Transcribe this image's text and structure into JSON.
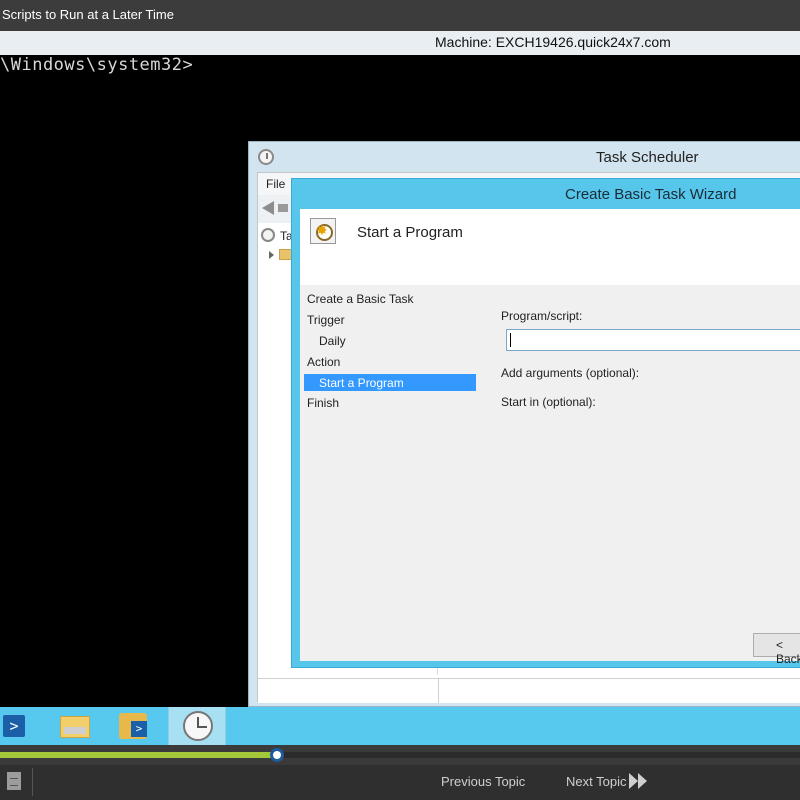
{
  "header": {
    "title": "Scripts to Run at a Later Time",
    "machine": "Machine: EXCH19426.quick24x7.com"
  },
  "console": {
    "line": "\\Windows\\system32>"
  },
  "task_scheduler": {
    "title": "Task Scheduler",
    "menu_file": "File",
    "tree_root": "Ta"
  },
  "wizard": {
    "title": "Create Basic Task Wizard",
    "heading": "Start a Program",
    "steps": [
      {
        "label": "Create a Basic Task"
      },
      {
        "label": "Trigger"
      },
      {
        "label": "Daily"
      },
      {
        "label": "Action"
      },
      {
        "label": "Start a Program"
      },
      {
        "label": "Finish"
      }
    ],
    "program_label": "Program/script:",
    "program_value": "",
    "args_label": "Add arguments (optional):",
    "start_in_label": "Start in (optional):",
    "back_label": "< Back"
  },
  "taskbar": {
    "items": [
      {
        "icon": "powershell-icon"
      },
      {
        "icon": "file-explorer-icon"
      },
      {
        "icon": "server-manager-icon"
      },
      {
        "icon": "task-scheduler-icon",
        "active": true
      }
    ]
  },
  "player": {
    "progress": 0.346,
    "prev_label": "Previous Topic",
    "next_label": "Next Topic",
    "accent": "#a4c639"
  }
}
